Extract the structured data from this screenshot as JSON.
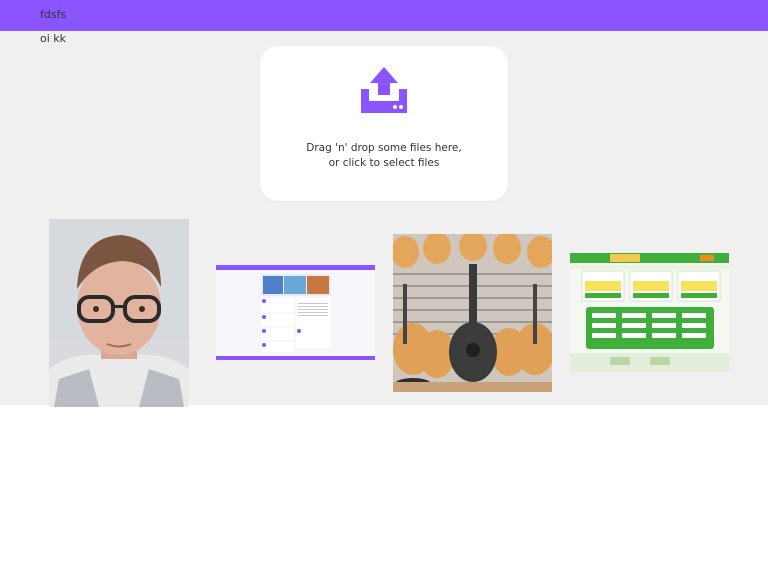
{
  "header": {
    "title": "fdsfs"
  },
  "subtitle": "oi kk",
  "dropzone": {
    "icon": "upload-icon",
    "line1": "Drag 'n' drop some files here,",
    "line2": "or click to select files"
  },
  "colors": {
    "accent": "#8a55ff",
    "background": "#f0f0f0"
  },
  "thumbnails": [
    {
      "kind": "portrait-photo"
    },
    {
      "kind": "website-screenshot-purple"
    },
    {
      "kind": "guitars-photo"
    },
    {
      "kind": "website-screenshot-green"
    }
  ]
}
